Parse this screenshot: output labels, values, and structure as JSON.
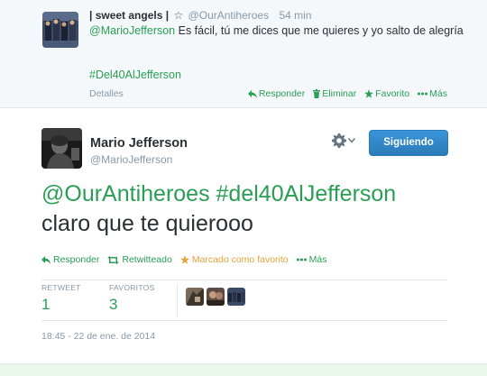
{
  "reply": {
    "name": "| sweet angels |",
    "star": "☆",
    "handle": "@OurAntiheroes",
    "time": "54 min",
    "mention": "@MarioJefferson",
    "text": " Es fácil, tú me dices que me quieres y yo salto de alegría",
    "hashtag": "#Del40AlJefferson",
    "details": "Detalles",
    "actions": {
      "reply": "Responder",
      "delete": "Eliminar",
      "favorite": "Favorito",
      "more": "Más"
    }
  },
  "tweet": {
    "name": "Mario Jefferson",
    "handle": "@MarioJefferson",
    "follow_label": "Siguiendo",
    "mention": "@OurAntiheroes",
    "hashtag": "#del40AlJefferson",
    "text": "claro que te quierooo",
    "actions": {
      "reply": "Responder",
      "retweeted": "Retwitteado",
      "favorited": "Marcado como favorito",
      "more": "Más"
    },
    "stats": {
      "retweet_label": "RETWEET",
      "retweet_count": "1",
      "favorites_label": "FAVORITOS",
      "favorites_count": "3"
    },
    "timestamp": "18:45 - 22 de ene. de 2014"
  },
  "colors": {
    "link_green": "#2a9e55",
    "favorite_orange": "#e5a13a",
    "follow_blue": "#2b7bb9",
    "muted": "#8899a6"
  },
  "icons": [
    "reply-arrow-icon",
    "trash-icon",
    "star-icon",
    "more-dots-icon",
    "gear-icon",
    "chevron-down-icon",
    "retweet-icon"
  ]
}
